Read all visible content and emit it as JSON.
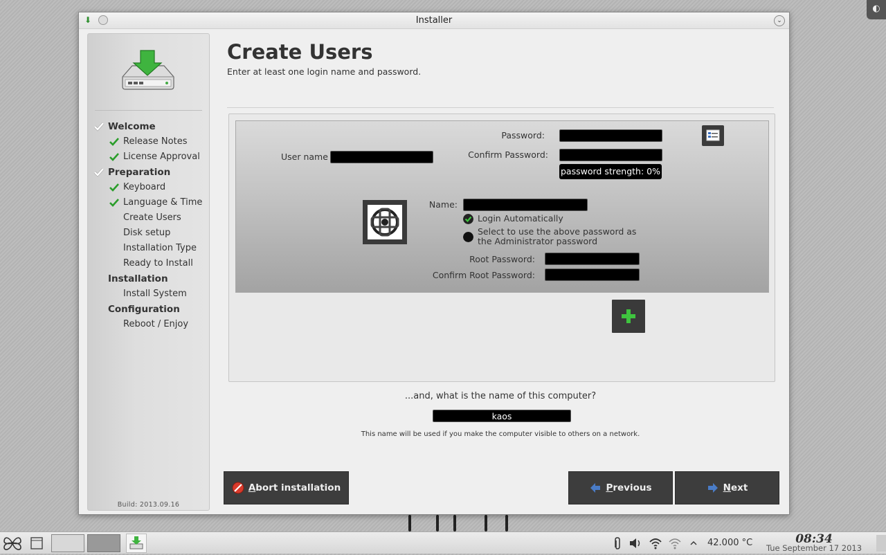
{
  "window": {
    "title": "Installer"
  },
  "sidebar": {
    "steps": [
      {
        "label": "Welcome",
        "type": "section",
        "done": true
      },
      {
        "label": "Release Notes",
        "type": "sub",
        "done": true
      },
      {
        "label": "License Approval",
        "type": "sub",
        "done": true
      },
      {
        "label": "Preparation",
        "type": "section",
        "done": true
      },
      {
        "label": "Keyboard",
        "type": "sub",
        "done": true
      },
      {
        "label": "Language & Time",
        "type": "sub",
        "done": true
      },
      {
        "label": "Create Users",
        "type": "sub",
        "done": false
      },
      {
        "label": "Disk setup",
        "type": "sub",
        "done": false
      },
      {
        "label": "Installation Type",
        "type": "sub",
        "done": false
      },
      {
        "label": "Ready to Install",
        "type": "sub",
        "done": false
      },
      {
        "label": "Installation",
        "type": "section",
        "done": false
      },
      {
        "label": "Install System",
        "type": "sub",
        "done": false
      },
      {
        "label": "Configuration",
        "type": "section",
        "done": false
      },
      {
        "label": "Reboot / Enjoy",
        "type": "sub",
        "done": false
      }
    ],
    "build": "Build: 2013.09.16"
  },
  "main": {
    "title": "Create Users",
    "subtitle": "Enter at least one login name and password."
  },
  "user_card": {
    "password_label": "Password:",
    "password_value": "",
    "confirm_password_label": "Confirm Password:",
    "confirm_password_value": "",
    "username_label": "User name",
    "username_value": "",
    "password_strength": "password strength: 0%",
    "name_label": "Name:",
    "name_value": "",
    "login_automatically": "Login Automatically",
    "login_automatically_checked": true,
    "use_as_admin_line1": "Select to use the above password as",
    "use_as_admin_line2": "the Administrator password",
    "use_as_admin_checked": false,
    "root_password_label": "Root Password:",
    "root_password_value": "",
    "confirm_root_password_label": "Confirm Root Password:",
    "confirm_root_password_value": ""
  },
  "hostname": {
    "question": "...and, what is the name of this computer?",
    "value": "kaos",
    "note": "This name will be used if you make the computer visible to others on a network."
  },
  "buttons": {
    "abort": {
      "mnemonic": "A",
      "rest": "bort installation"
    },
    "previous": {
      "mnemonic": "P",
      "rest": "revious"
    },
    "next": {
      "mnemonic": "N",
      "rest": "ext"
    }
  },
  "taskbar": {
    "temperature": "42.000 °C",
    "time": "08:34",
    "date": "Tue September 17 2013"
  },
  "colors": {
    "check_green": "#2a9d2a",
    "button_dark": "#3d3d3d",
    "field_black": "#000000",
    "abort_red": "#d93a2b",
    "arrow_blue": "#4a7cc7"
  },
  "icons": {
    "app": "installer-icon",
    "logo": "hard-drive-download-icon",
    "check": "checkmark-icon",
    "add": "plus-icon",
    "abort": "cancel-icon",
    "previous": "arrow-left-icon",
    "next": "arrow-right-icon"
  }
}
